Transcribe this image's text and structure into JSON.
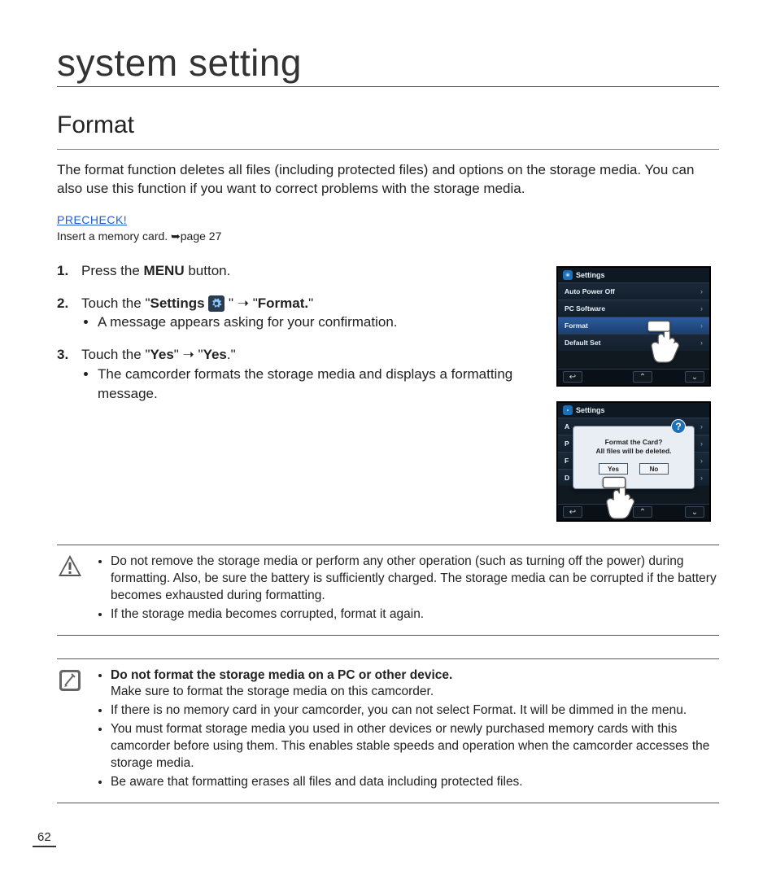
{
  "chapter_title": "system setting",
  "section_title": "Format",
  "intro": "The format function deletes all files (including protected files) and options on the storage media. You can also use this function if you want to correct problems with the storage media.",
  "precheck": {
    "label": "PRECHECK!",
    "text": "Insert a memory card. ➥page 27"
  },
  "steps": {
    "s1": {
      "pre": "Press the ",
      "bold": "MENU",
      "post": " button."
    },
    "s2": {
      "pre": "Touch the \"",
      "bold1": "Settings",
      "mid": " \" ➝ \"",
      "bold2": "Format.",
      "post": "\"",
      "bullet": "A message appears asking for your confirmation."
    },
    "s3": {
      "pre": "Touch the \"",
      "bold1": "Yes",
      "mid": "\" ➝ \"",
      "bold2": "Yes",
      "post": ".\"",
      "bullet": "The camcorder formats the storage media and displays a formatting message."
    }
  },
  "fig1": {
    "title": "Settings",
    "rows": [
      "Auto Power Off",
      "PC Software",
      "Format",
      "Default Set"
    ]
  },
  "fig2": {
    "title": "Settings",
    "dialog": {
      "line1": "Format  the Card?",
      "line2": "All files will be deleted.",
      "yes": "Yes",
      "no": "No"
    }
  },
  "warning_notes": [
    "Do not remove the storage media or perform any other operation (such as turning off the power) during formatting. Also, be sure the battery is sufficiently charged. The storage media can be corrupted if the battery becomes exhausted during formatting.",
    "If the storage media becomes corrupted, format it again."
  ],
  "info_notes": {
    "n1_bold": "Do not format the storage media on a PC or other device.",
    "n1_sub": "Make sure to format the storage media on this camcorder.",
    "n2": "If there is no memory card in your camcorder, you can not select Format. It will be dimmed in the menu.",
    "n3": "You must format storage media you used in other devices or newly purchased memory cards with this camcorder before using them. This enables stable speeds and operation when the camcorder accesses the storage media.",
    "n4": "Be aware that formatting erases all files and data including protected files."
  },
  "page_number": "62"
}
